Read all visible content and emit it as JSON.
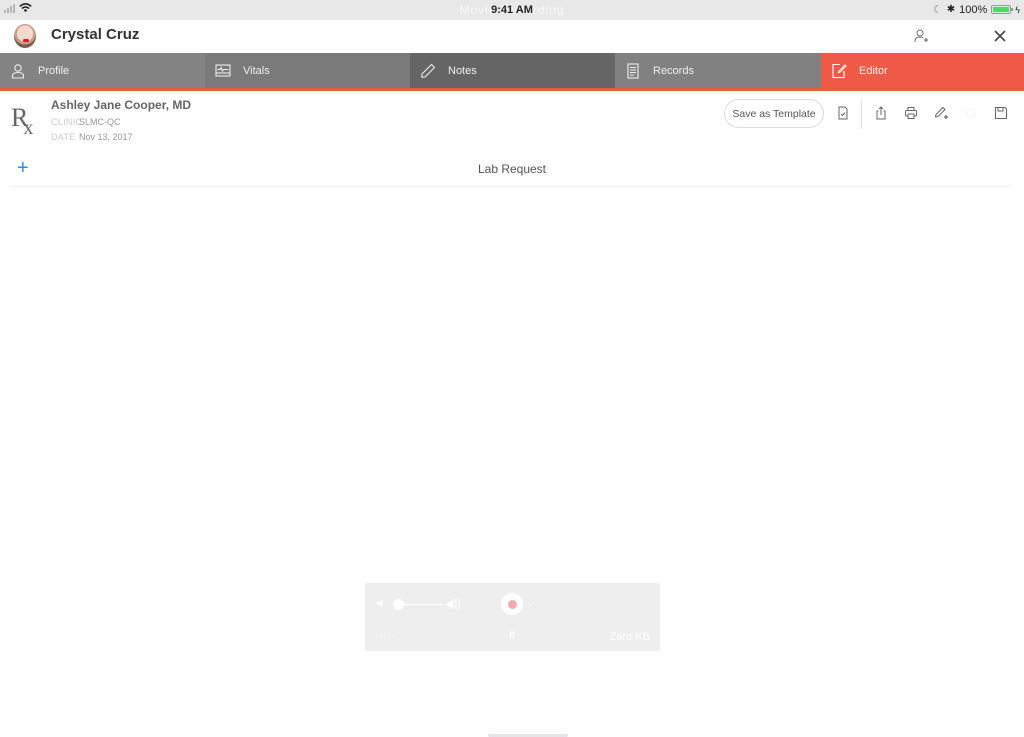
{
  "status_bar": {
    "time": "9:41 AM",
    "overlay_text": "Movie Recording",
    "battery_percent": "100%",
    "icons": [
      "signal-icon",
      "wifi-icon",
      "moon-icon",
      "bluetooth-icon",
      "battery-icon",
      "charging-icon"
    ]
  },
  "header": {
    "patient_name": "Crystal Cruz",
    "icons": {
      "avatar": "patient-photo",
      "add_user": "add-user-icon",
      "close": "close-icon"
    }
  },
  "tabs": [
    {
      "label": "Profile",
      "icon": "person-icon",
      "active": false
    },
    {
      "label": "Vitals",
      "icon": "vitals-monitor-icon",
      "active": false
    },
    {
      "label": "Notes",
      "icon": "pencil-icon",
      "active": false
    },
    {
      "label": "Records",
      "icon": "document-icon",
      "active": false
    },
    {
      "label": "Editor",
      "icon": "edit-document-icon",
      "active": true
    }
  ],
  "colors": {
    "accent": "#ef5a47",
    "link_blue": "#2e8be6"
  },
  "document": {
    "rx_symbol": "R",
    "rx_sub": "x",
    "doctor": "Ashley Jane Cooper, MD",
    "clinic_label": "CLINIC",
    "clinic_value": "SLMC-QC",
    "date_label": "DATE",
    "date_value": "Nov 13, 2017"
  },
  "toolbar": {
    "save_template_label": "Save as Template",
    "icons": [
      "checklist-icon",
      "share-icon",
      "print-icon",
      "edit-add-icon",
      "blank-icon",
      "save-icon"
    ]
  },
  "section": {
    "add_symbol": "+",
    "title": "Lab Request"
  },
  "recorder": {
    "time": "--:--",
    "size": "Zero KB",
    "pause_symbol": "II",
    "chevron": "⌄"
  }
}
